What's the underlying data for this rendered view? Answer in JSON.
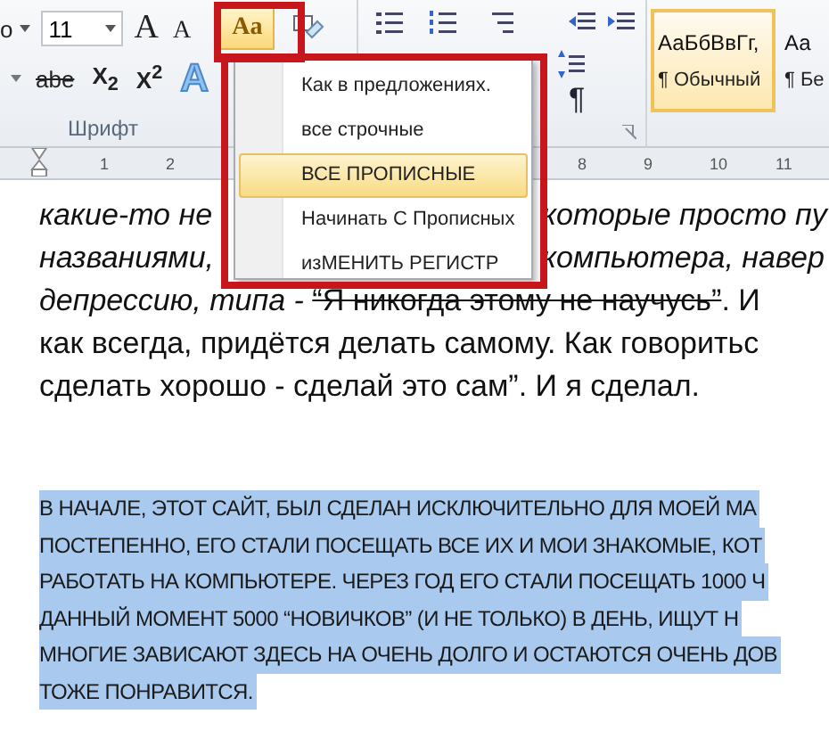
{
  "ribbon": {
    "font_name": "о",
    "font_size": "11",
    "grow_font": "A",
    "shrink_font": "A",
    "change_case": "Aa",
    "strikethrough": "abe",
    "subscript": "X$_{2}$",
    "superscript": "X$^{2}$",
    "text_effects": "A",
    "group_label": "Шрифт",
    "pilcrow": "¶",
    "styles": [
      {
        "sample": "АаБбВвГг,",
        "name": "¶ Обычный",
        "selected": true
      },
      {
        "sample": "Аа",
        "name": "¶ Бе",
        "selected": false
      }
    ]
  },
  "ruler": {
    "left_labels": [
      "1",
      "2"
    ],
    "right_labels": [
      "8",
      "9",
      "10",
      "11"
    ]
  },
  "case_menu": {
    "items": [
      {
        "label": "Как в предложениях.",
        "selected": false
      },
      {
        "label": "все строчные",
        "selected": false
      },
      {
        "label": "ВСЕ ПРОПИСНЫЕ",
        "selected": true
      },
      {
        "label": "Начинать С Прописных",
        "selected": false
      },
      {
        "label": "изМЕНИТЬ РЕГИСТР",
        "selected": false
      }
    ]
  },
  "document": {
    "lines": [
      {
        "before_menu": [
          {
            "text": "какие-то не",
            "kind": "italic"
          }
        ],
        "after_menu": [
          {
            "text": "которые просто пу",
            "kind": "italic"
          }
        ]
      },
      {
        "before_menu": [
          {
            "text": "названиями,",
            "kind": "italic"
          }
        ],
        "after_menu": [
          {
            "text": "компьютера, навер",
            "kind": "italic"
          }
        ]
      },
      {
        "before_menu": [
          {
            "text": "депрессию, типа - ",
            "kind": "italic"
          },
          {
            "text": "“Я никогда этому не научусь”",
            "kind": "strike"
          },
          {
            "text": ". И",
            "kind": "normal"
          }
        ]
      },
      {
        "before_menu": [
          {
            "text": "как всегда, придётся делать самому. Как говоритьс",
            "kind": "normal"
          }
        ]
      },
      {
        "before_menu": [
          {
            "text": "сделать хорошо - сделай это сам”. И я сделал.",
            "kind": "normal"
          }
        ]
      }
    ],
    "selected_paragraph": [
      "В НАЧАЛЕ, ЭТОТ САЙТ, БЫЛ СДЕЛАН ИСКЛЮЧИТЕЛЬНО ДЛЯ МОЕЙ МА",
      "ПОСТЕПЕННО, ЕГО СТАЛИ ПОСЕЩАТЬ ВСЕ ИХ И МОИ ЗНАКОМЫЕ, КОТ",
      "РАБОТАТЬ НА КОМПЬЮТЕРЕ. ЧЕРЕЗ ГОД ЕГО СТАЛИ ПОСЕЩАТЬ 1000 Ч",
      "ДАННЫЙ МОМЕНТ  5000 “НОВИЧКОВ” (И НЕ ТОЛЬКО) В ДЕНЬ, ИЩУТ Н",
      "МНОГИЕ ЗАВИСАЮТ ЗДЕСЬ НА ОЧЕНЬ ДОЛГО И ОСТАЮТСЯ ОЧЕНЬ ДОВ",
      "ТОЖЕ ПОНРАВИТСЯ."
    ]
  }
}
